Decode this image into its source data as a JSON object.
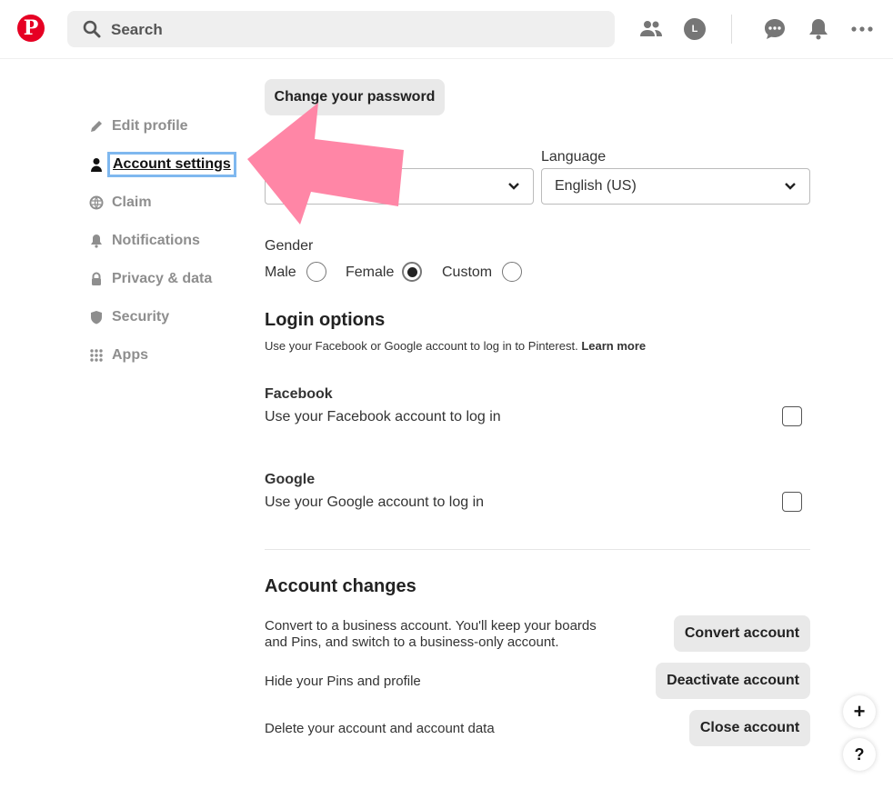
{
  "header": {
    "search_placeholder": "Search",
    "avatar_letter": "L"
  },
  "sidebar": {
    "items": [
      {
        "label": "Edit profile",
        "icon": "pencil-icon"
      },
      {
        "label": "Account settings",
        "icon": "person-icon"
      },
      {
        "label": "Claim",
        "icon": "globe-icon"
      },
      {
        "label": "Notifications",
        "icon": "bell-icon"
      },
      {
        "label": "Privacy & data",
        "icon": "lock-icon"
      },
      {
        "label": "Security",
        "icon": "shield-icon"
      },
      {
        "label": "Apps",
        "icon": "grid-icon"
      }
    ],
    "active_index": 1
  },
  "main": {
    "change_password_label": "Change your password",
    "language_label": "Language",
    "language_value": "English (US)",
    "gender_label": "Gender",
    "gender_options": [
      "Male",
      "Female",
      "Custom"
    ],
    "gender_selected": "Female",
    "login_title": "Login options",
    "login_desc": "Use your Facebook or Google account to log in to Pinterest.",
    "learn_more": "Learn more",
    "facebook_title": "Facebook",
    "facebook_desc": "Use your Facebook account to log in",
    "google_title": "Google",
    "google_desc": "Use your Google account to log in",
    "changes_title": "Account changes",
    "convert_desc_1": "Convert to a business account. You'll keep your boards",
    "convert_desc_2": "and Pins, and switch to a business-only account.",
    "convert_label": "Convert account",
    "hide_desc": "Hide your Pins and profile",
    "deactivate_label": "Deactivate account",
    "delete_desc": "Delete your account and account data",
    "close_label": "Close account"
  },
  "fab": {
    "plus": "+",
    "help": "?"
  },
  "colors": {
    "brand": "#e60023",
    "arrow": "#ff86a6",
    "focus_outline": "#7fb8ef"
  }
}
